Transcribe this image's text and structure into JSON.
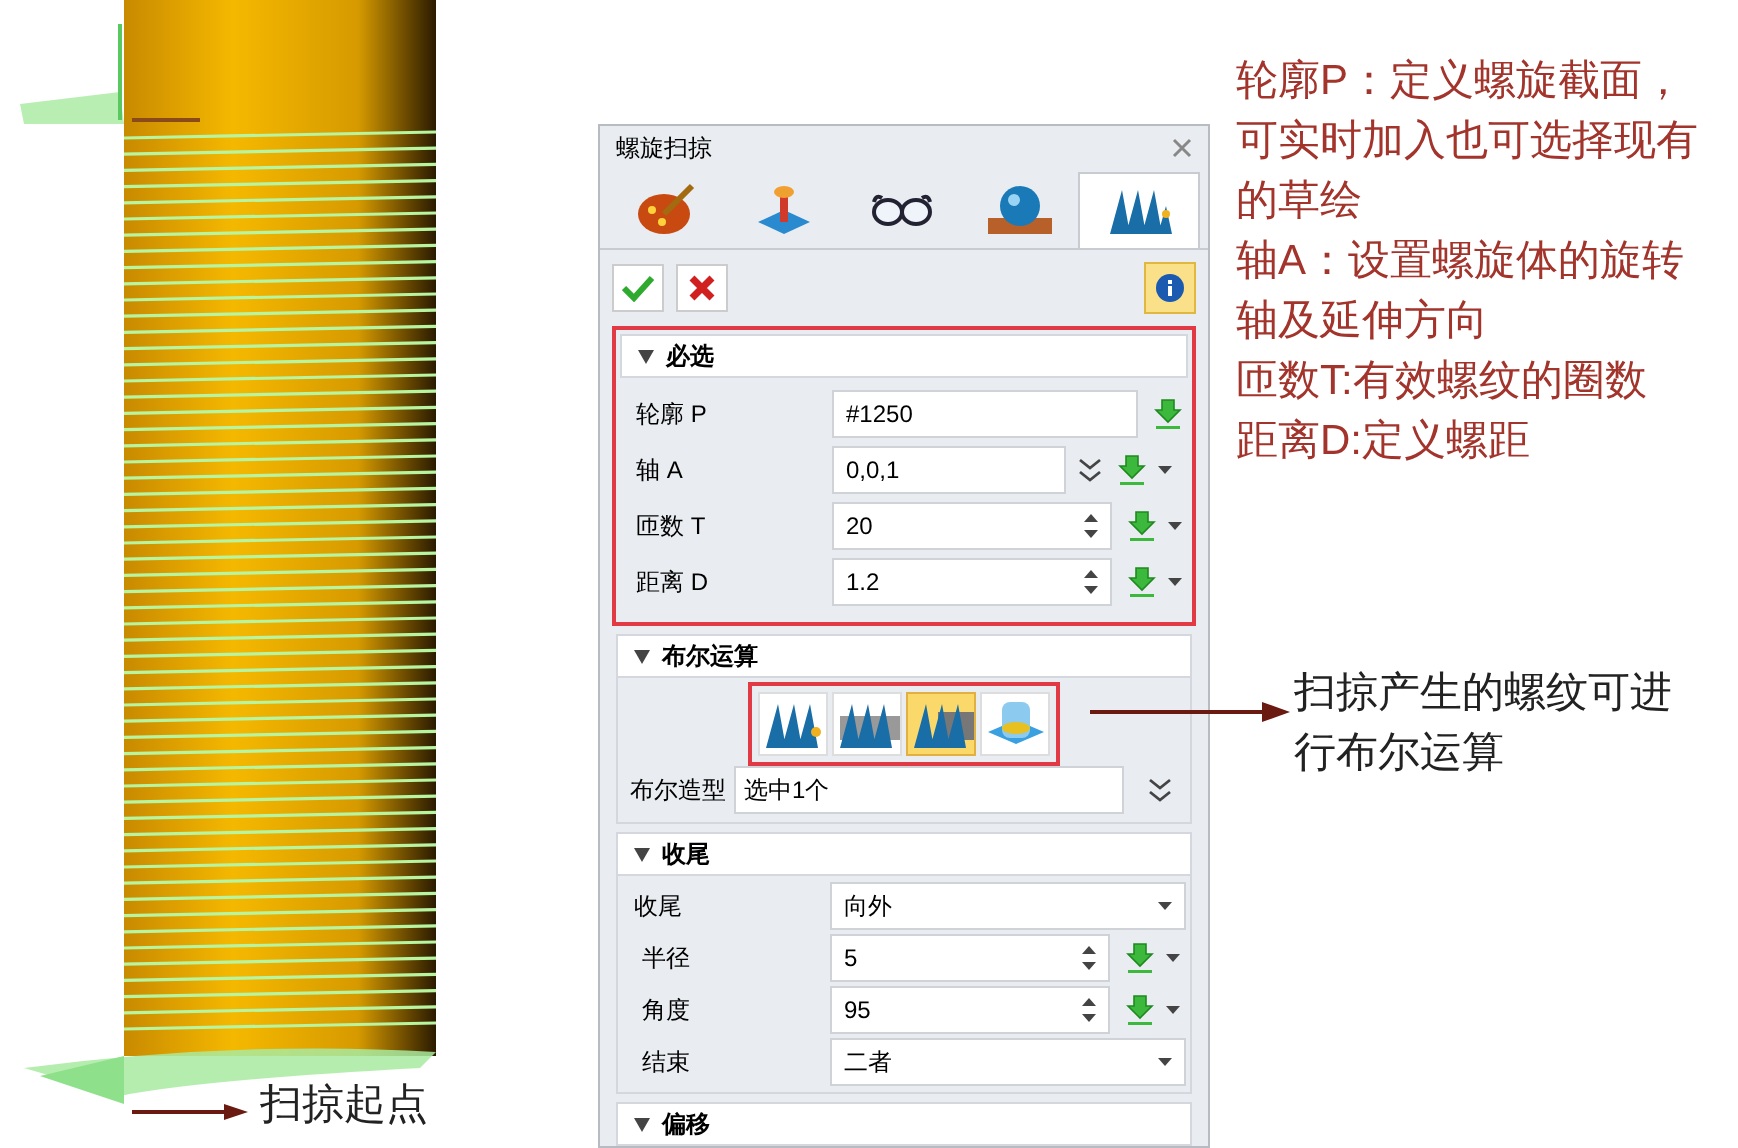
{
  "viewport": {
    "start_label": "扫掠起点"
  },
  "dialog": {
    "title": "螺旋扫掠",
    "tabs": [
      {
        "selected": false
      },
      {
        "selected": false
      },
      {
        "selected": false
      },
      {
        "selected": false
      },
      {
        "selected": true
      }
    ],
    "info_active": true,
    "required": {
      "title": "必选",
      "expanded": true,
      "highlighted": true,
      "rows": [
        {
          "label": "轮廓 P",
          "value": "#1250",
          "kind": "pick"
        },
        {
          "label": "轴 A",
          "value": "0,0,1",
          "kind": "vector"
        },
        {
          "label": "匝数 T",
          "value": "20",
          "kind": "spin"
        },
        {
          "label": "距离 D",
          "value": "1.2",
          "kind": "spin"
        }
      ]
    },
    "boolean": {
      "title": "布尔运算",
      "expanded": true,
      "highlighted": true,
      "ops": [
        {
          "selected": false
        },
        {
          "selected": false
        },
        {
          "selected": true
        },
        {
          "selected": false
        }
      ],
      "field_label": "布尔造型",
      "field_value": "选中1个"
    },
    "ending": {
      "title": "收尾",
      "expanded": true,
      "rows": [
        {
          "label": "收尾",
          "value": "向外",
          "kind": "dropdown"
        },
        {
          "label": "半径",
          "value": "5",
          "kind": "spin"
        },
        {
          "label": "角度",
          "value": "95",
          "kind": "spin"
        },
        {
          "label": "结束",
          "value": "二者",
          "kind": "dropdown"
        }
      ]
    },
    "offset": {
      "title": "偏移",
      "expanded": true
    }
  },
  "notes": [
    "轮廓P：定义螺旋截面，可实时加入也可选择现有的草绘",
    "轴A：设置螺旋体的旋转轴及延伸方向",
    "匝数T:有效螺纹的圈数",
    "距离D:定义螺距"
  ],
  "callout": "扫掠产生的螺纹可进行布尔运算"
}
